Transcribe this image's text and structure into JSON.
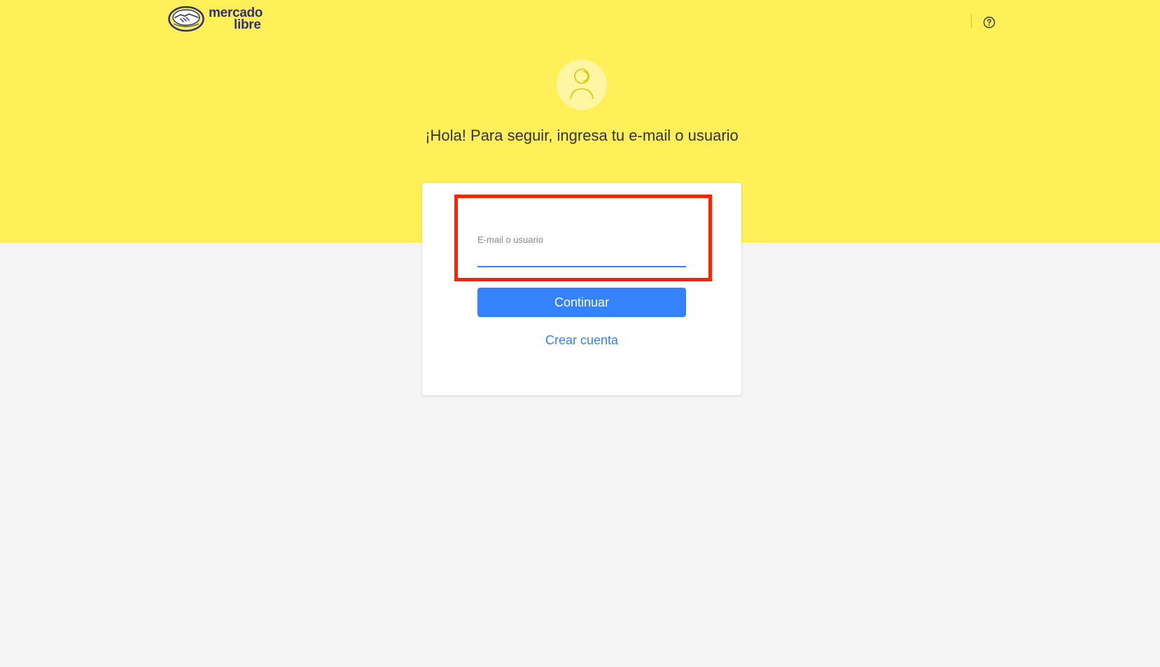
{
  "header": {
    "logo_line1": "mercado",
    "logo_line2": "libre",
    "help_icon": "question-circle-icon"
  },
  "login": {
    "avatar_icon": "user-avatar-icon",
    "greeting": "¡Hola! Para seguir, ingresa tu e-mail o usuario",
    "field_label": "E-mail o usuario",
    "field_value": "",
    "continue_label": "Continuar",
    "create_account_label": "Crear cuenta"
  },
  "colors": {
    "brand_yellow": "#fff059",
    "primary_blue": "#3483fa",
    "highlight_red": "#ff2200",
    "logo_navy": "#2d3277"
  }
}
